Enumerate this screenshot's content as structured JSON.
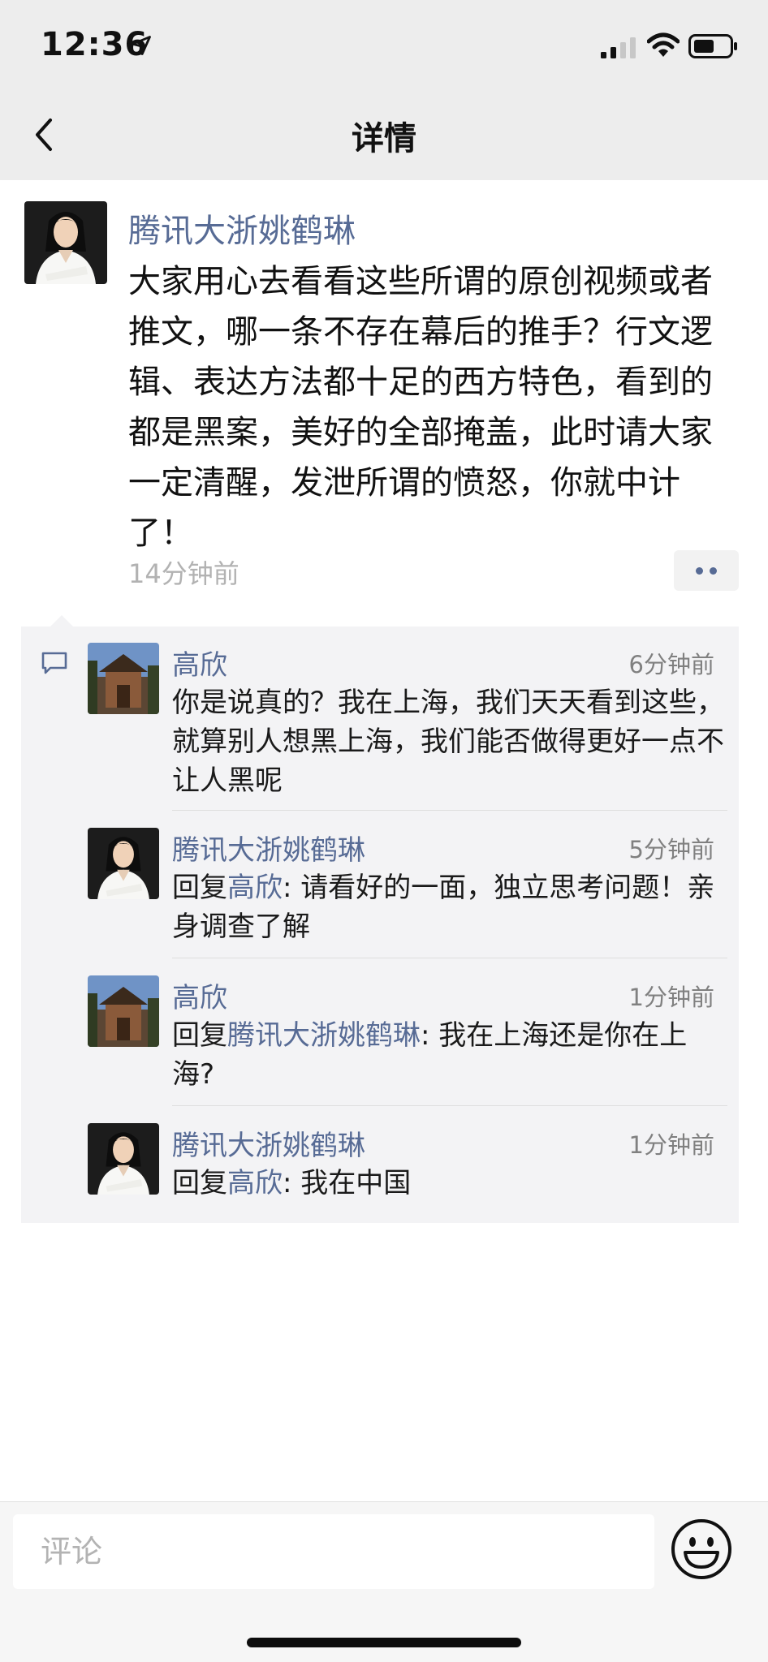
{
  "status_bar": {
    "time": "12:36"
  },
  "nav": {
    "title": "详情"
  },
  "post": {
    "author": "腾讯大浙姚鹤琳",
    "text": "大家用心去看看这些所谓的原创视频或者推文，哪一条不存在幕后的推手？行文逻辑、表达方法都十足的西方特色，看到的都是黑案，美好的全部掩盖，此时请大家一定清醒，发泄所谓的愤怒，你就中计了！",
    "time": "14分钟前"
  },
  "comments": [
    {
      "name": "高欣",
      "time": "6分钟前",
      "text": "你是说真的？我在上海，我们天天看到这些，就算别人想黑上海，我们能否做得更好一点不让人黑呢"
    },
    {
      "name": "腾讯大浙姚鹤琳",
      "time": "5分钟前",
      "reply_prefix": "回复",
      "reply_to": "高欣",
      "text": ": 请看好的一面，独立思考问题！亲身调查了解"
    },
    {
      "name": "高欣",
      "time": "1分钟前",
      "reply_prefix": "回复",
      "reply_to": "腾讯大浙姚鹤琳",
      "text": ": 我在上海还是你在上海?"
    },
    {
      "name": "腾讯大浙姚鹤琳",
      "time": "1分钟前",
      "reply_prefix": "回复",
      "reply_to": "高欣",
      "text": ": 我在中国"
    }
  ],
  "input": {
    "placeholder": "评论"
  },
  "colors": {
    "link": "#576b95",
    "panel": "#f3f3f5",
    "header": "#ededed"
  }
}
